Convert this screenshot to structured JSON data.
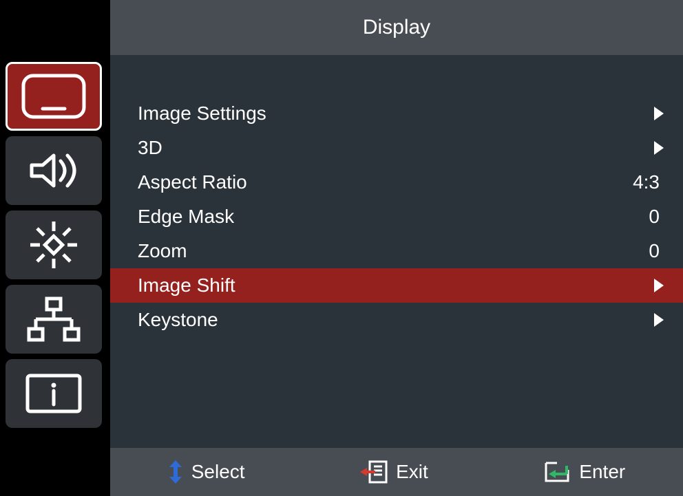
{
  "title": "Display",
  "sidebar": {
    "items": [
      {
        "name": "display",
        "icon": "monitor-icon",
        "selected": true
      },
      {
        "name": "audio",
        "icon": "speaker-icon",
        "selected": false
      },
      {
        "name": "setup",
        "icon": "gear-icon",
        "selected": false
      },
      {
        "name": "network",
        "icon": "network-icon",
        "selected": false
      },
      {
        "name": "info",
        "icon": "info-icon",
        "selected": false
      }
    ]
  },
  "menu": {
    "items": [
      {
        "label": "Image Settings",
        "type": "submenu",
        "highlight": false
      },
      {
        "label": "3D",
        "type": "submenu",
        "highlight": false
      },
      {
        "label": "Aspect Ratio",
        "type": "value",
        "value": "4:3",
        "highlight": false
      },
      {
        "label": "Edge Mask",
        "type": "value",
        "value": "0",
        "highlight": false
      },
      {
        "label": "Zoom",
        "type": "value",
        "value": "0",
        "highlight": false
      },
      {
        "label": "Image Shift",
        "type": "submenu",
        "highlight": true
      },
      {
        "label": "Keystone",
        "type": "submenu",
        "highlight": false
      }
    ]
  },
  "footer": {
    "select": "Select",
    "exit": "Exit",
    "enter": "Enter"
  }
}
